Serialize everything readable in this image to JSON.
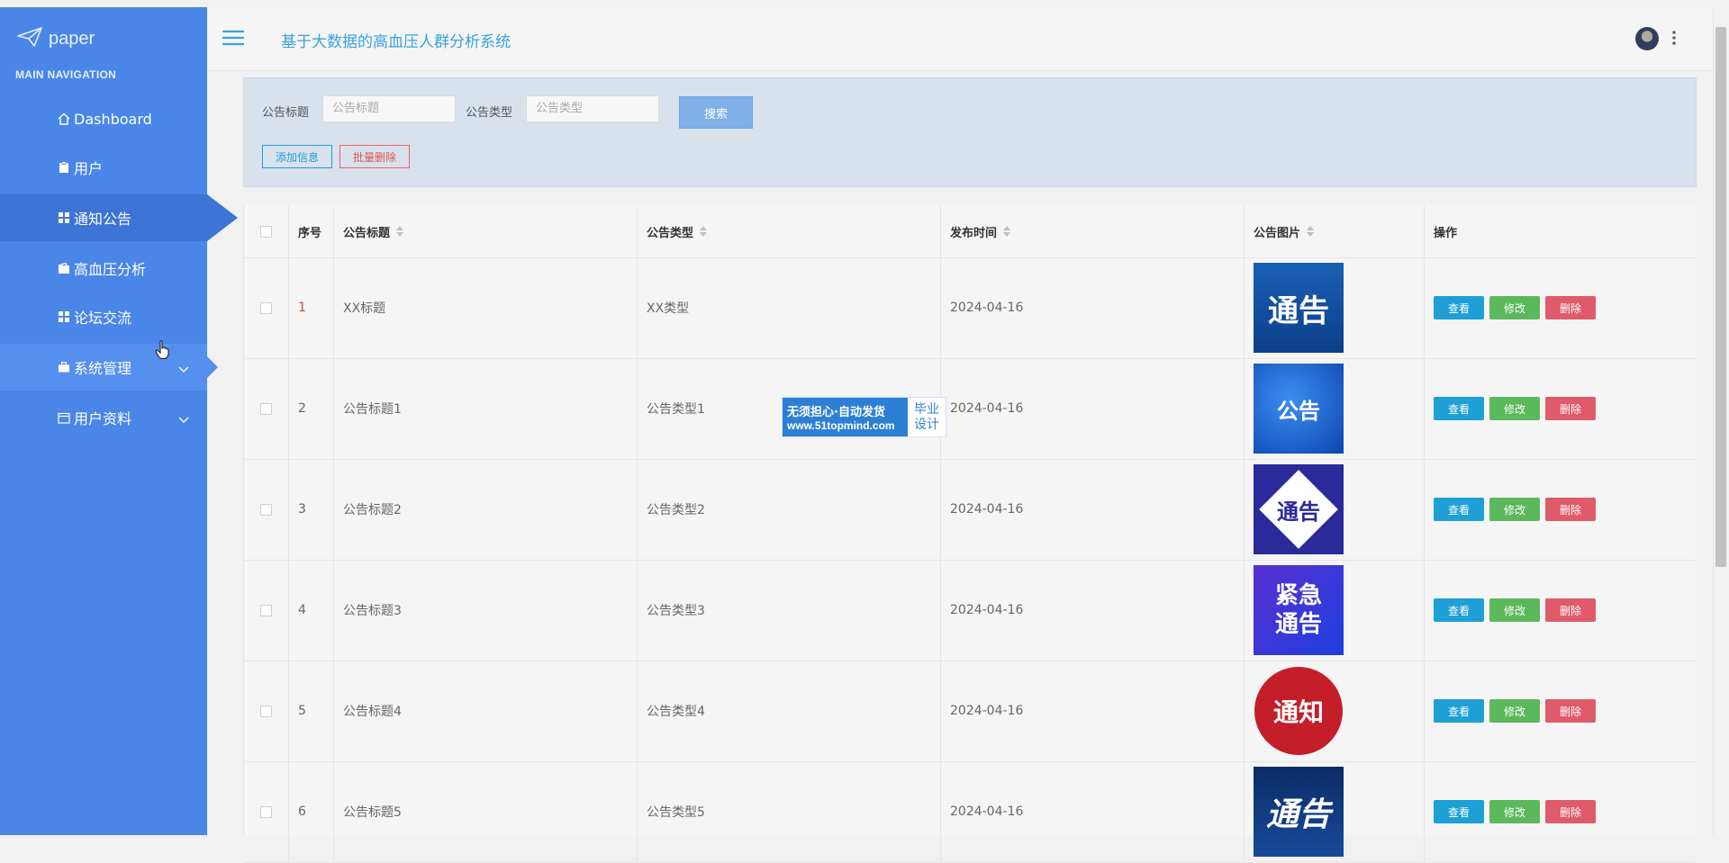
{
  "sidebar": {
    "brand": "paper",
    "heading": "MAIN NAVIGATION",
    "items": [
      {
        "label": "Dashboard",
        "icon": "home-icon"
      },
      {
        "label": "用户",
        "icon": "clipboard-icon"
      },
      {
        "label": "通知公告",
        "icon": "grid-icon"
      },
      {
        "label": "高血压分析",
        "icon": "wallet-icon"
      },
      {
        "label": "论坛交流",
        "icon": "grid-icon"
      },
      {
        "label": "系统管理",
        "icon": "briefcase-icon"
      },
      {
        "label": "用户资料",
        "icon": "calendar-icon"
      }
    ]
  },
  "header": {
    "title": "基于大数据的高血压人群分析系统"
  },
  "search": {
    "title_label": "公告标题",
    "title_placeholder": "公告标题",
    "type_label": "公告类型",
    "type_placeholder": "公告类型",
    "search_btn": "搜索",
    "add_btn": "添加信息",
    "batch_delete_btn": "批量删除"
  },
  "table": {
    "columns": [
      "序号",
      "公告标题",
      "公告类型",
      "发布时间",
      "公告图片",
      "操作"
    ],
    "rows": [
      {
        "no": "1",
        "title": "XX标题",
        "type": "XX类型",
        "time": "2024-04-16",
        "img_text": "通告"
      },
      {
        "no": "2",
        "title": "公告标题1",
        "type": "公告类型1",
        "time": "2024-04-16",
        "img_text": "公告"
      },
      {
        "no": "3",
        "title": "公告标题2",
        "type": "公告类型2",
        "time": "2024-04-16",
        "img_text": "通告"
      },
      {
        "no": "4",
        "title": "公告标题3",
        "type": "公告类型3",
        "time": "2024-04-16",
        "img_text": "紧急通告"
      },
      {
        "no": "5",
        "title": "公告标题4",
        "type": "公告类型4",
        "time": "2024-04-16",
        "img_text": "通知"
      },
      {
        "no": "6",
        "title": "公告标题5",
        "type": "公告类型5",
        "time": "2024-04-16",
        "img_text": "通告"
      }
    ],
    "ops": {
      "view": "查看",
      "edit": "修改",
      "delete": "删除"
    }
  },
  "watermark": {
    "line1": "无须担心·自动发货",
    "line2": "www.51topmind.com",
    "right1": "毕业",
    "right2": "设计"
  },
  "colors": {
    "sidebar": "#4a86e8",
    "accent": "#39a2db",
    "view": "#1e9fd6",
    "edit": "#5cb85c",
    "delete": "#df5a6a"
  }
}
